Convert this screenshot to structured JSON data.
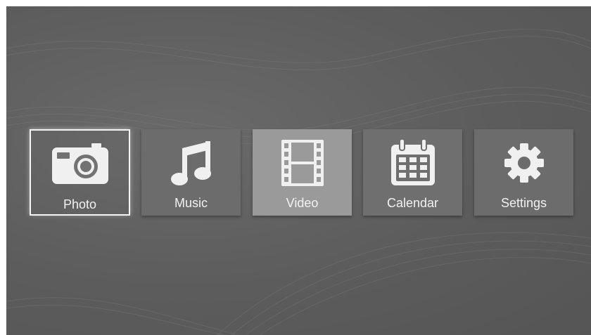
{
  "menu": {
    "items": [
      {
        "label": "Photo",
        "icon": "camera-icon",
        "bg": "#727272",
        "selected": true
      },
      {
        "label": "Music",
        "icon": "music-note-icon",
        "bg": "#6c6c6c",
        "selected": false
      },
      {
        "label": "Video",
        "icon": "film-strip-icon",
        "bg": "#9a9a9a",
        "selected": false
      },
      {
        "label": "Calendar",
        "icon": "calendar-icon",
        "bg": "#6f6f6f",
        "selected": false
      },
      {
        "label": "Settings",
        "icon": "gear-icon",
        "bg": "#6c6c6c",
        "selected": false
      }
    ]
  },
  "colors": {
    "background": "#5f5f5f",
    "icon": "#f0f0f0",
    "label": "#f2f2f2",
    "selection_border": "#f4f4f4"
  }
}
